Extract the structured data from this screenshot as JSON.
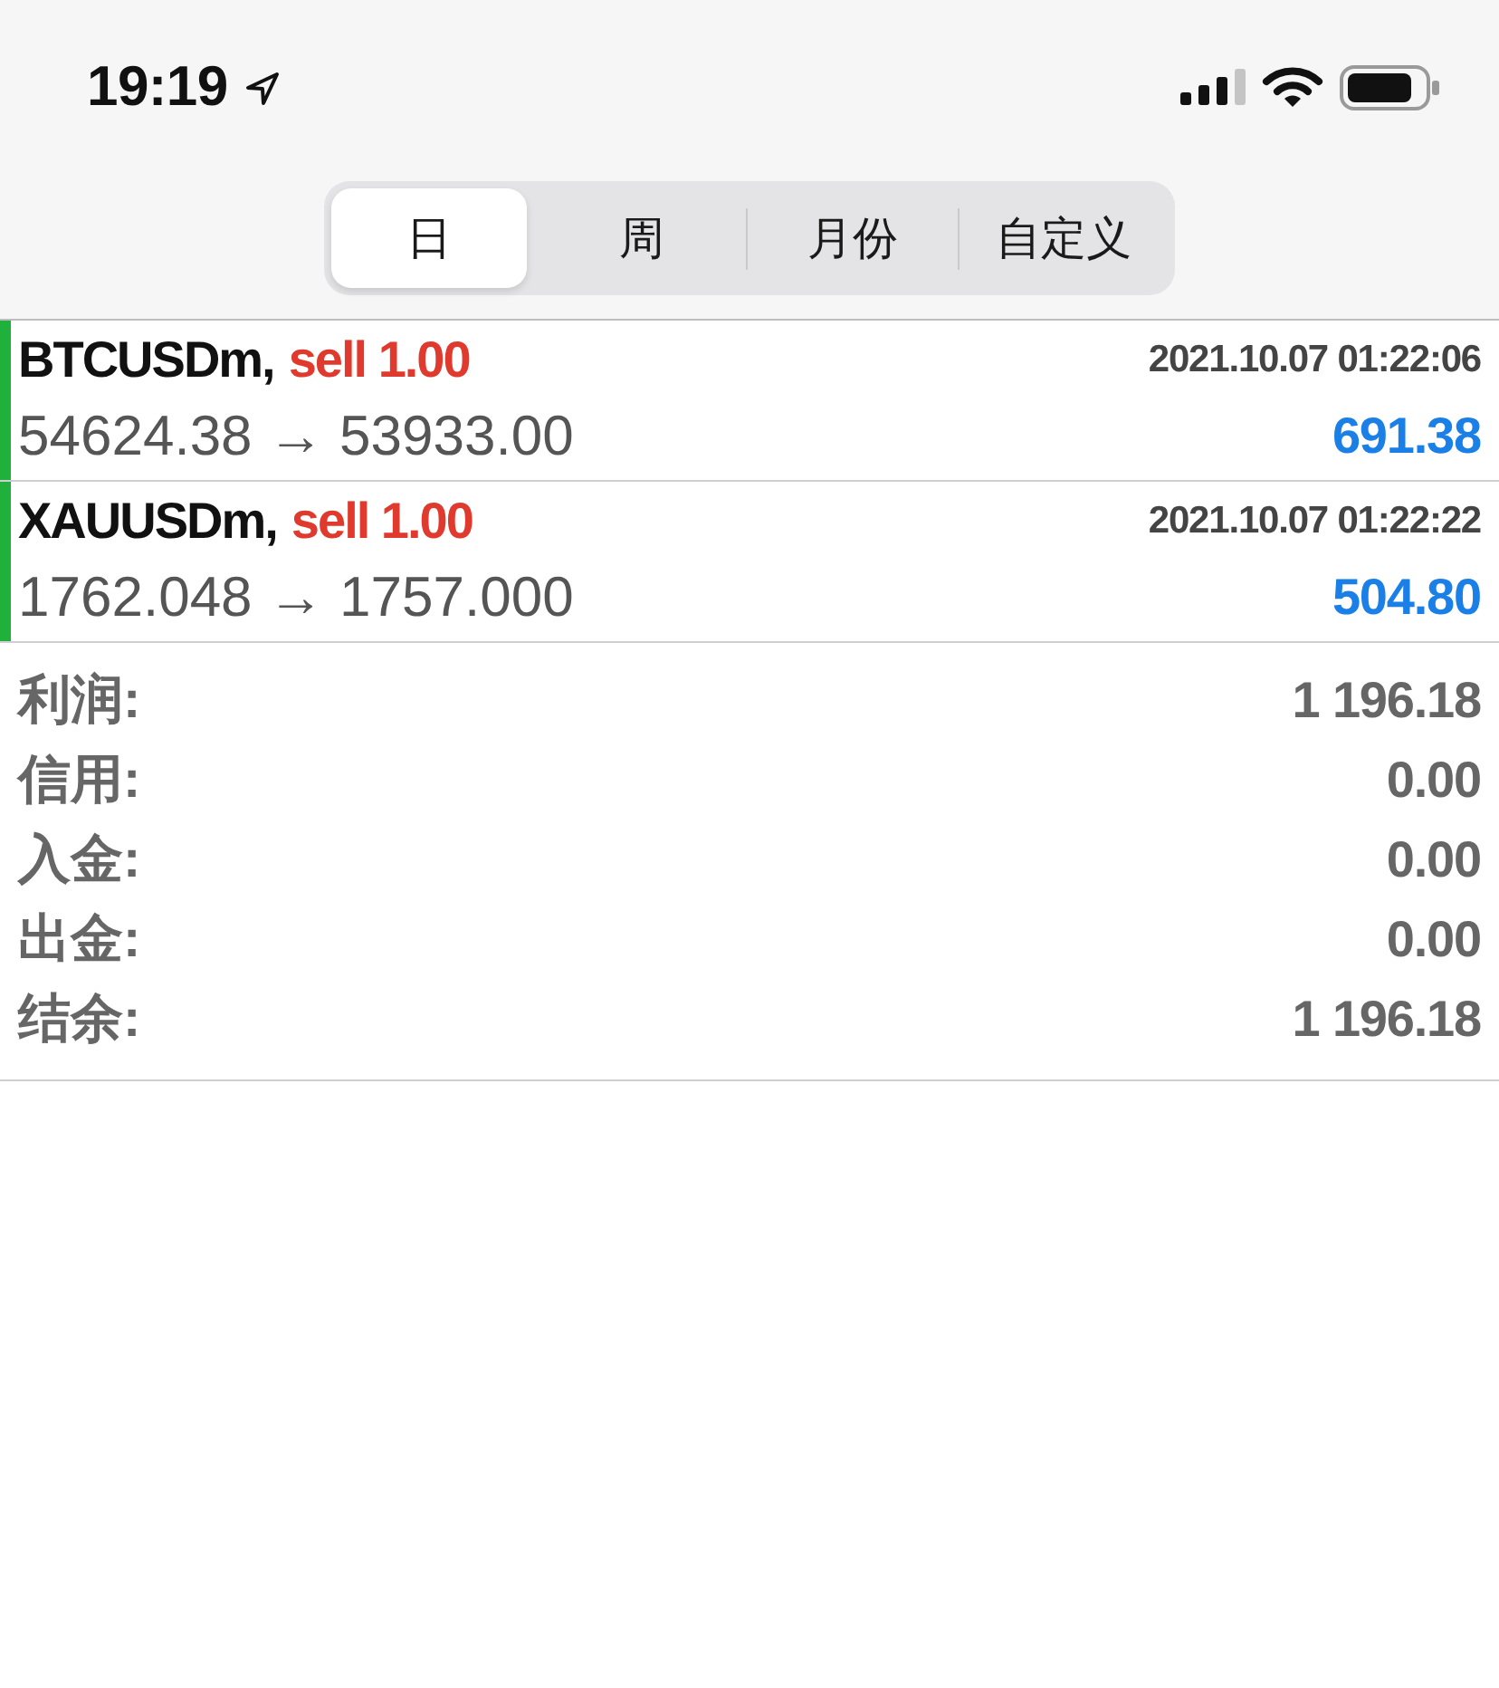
{
  "status_bar": {
    "time": "19:19"
  },
  "period_tabs": [
    {
      "label": "日",
      "selected": true
    },
    {
      "label": "周",
      "selected": false
    },
    {
      "label": "月份",
      "selected": false
    },
    {
      "label": "自定义",
      "selected": false
    }
  ],
  "orders": [
    {
      "symbol": "BTCUSDm,",
      "trade": "sell 1.00",
      "time": "2021.10.07 01:22:06",
      "prices": "54624.38 → 53933.00",
      "profit": "691.38"
    },
    {
      "symbol": "XAUUSDm,",
      "trade": "sell 1.00",
      "time": "2021.10.07 01:22:22",
      "prices": "1762.048 → 1757.000",
      "profit": "504.80"
    }
  ],
  "summary": [
    {
      "label": "利润:",
      "value": "1 196.18"
    },
    {
      "label": "信用:",
      "value": "0.00"
    },
    {
      "label": "入金:",
      "value": "0.00"
    },
    {
      "label": "出金:",
      "value": "0.00"
    },
    {
      "label": "结余:",
      "value": "1 196.18"
    }
  ]
}
